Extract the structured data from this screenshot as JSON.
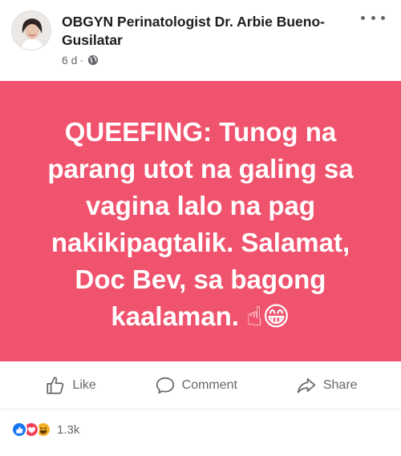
{
  "post": {
    "author": "OBGYN Perinatologist Dr. Arbie Bueno-Gusilatar",
    "time": "6 d",
    "separator": "·",
    "privacy_icon": "globe-icon",
    "menu_icon": "more-options-icon"
  },
  "content": {
    "text": "QUEEFING: Tunog na parang utot na galing sa vagina lalo na pag nakikipagtalik. Salamat, Doc Bev, sa bagong kaalaman. ☝😁",
    "background_color": "#f0536d",
    "text_color": "#ffffff"
  },
  "actions": {
    "like_label": "Like",
    "comment_label": "Comment",
    "share_label": "Share"
  },
  "reactions": {
    "types": [
      "like",
      "love",
      "haha"
    ],
    "count": "1.3k"
  }
}
